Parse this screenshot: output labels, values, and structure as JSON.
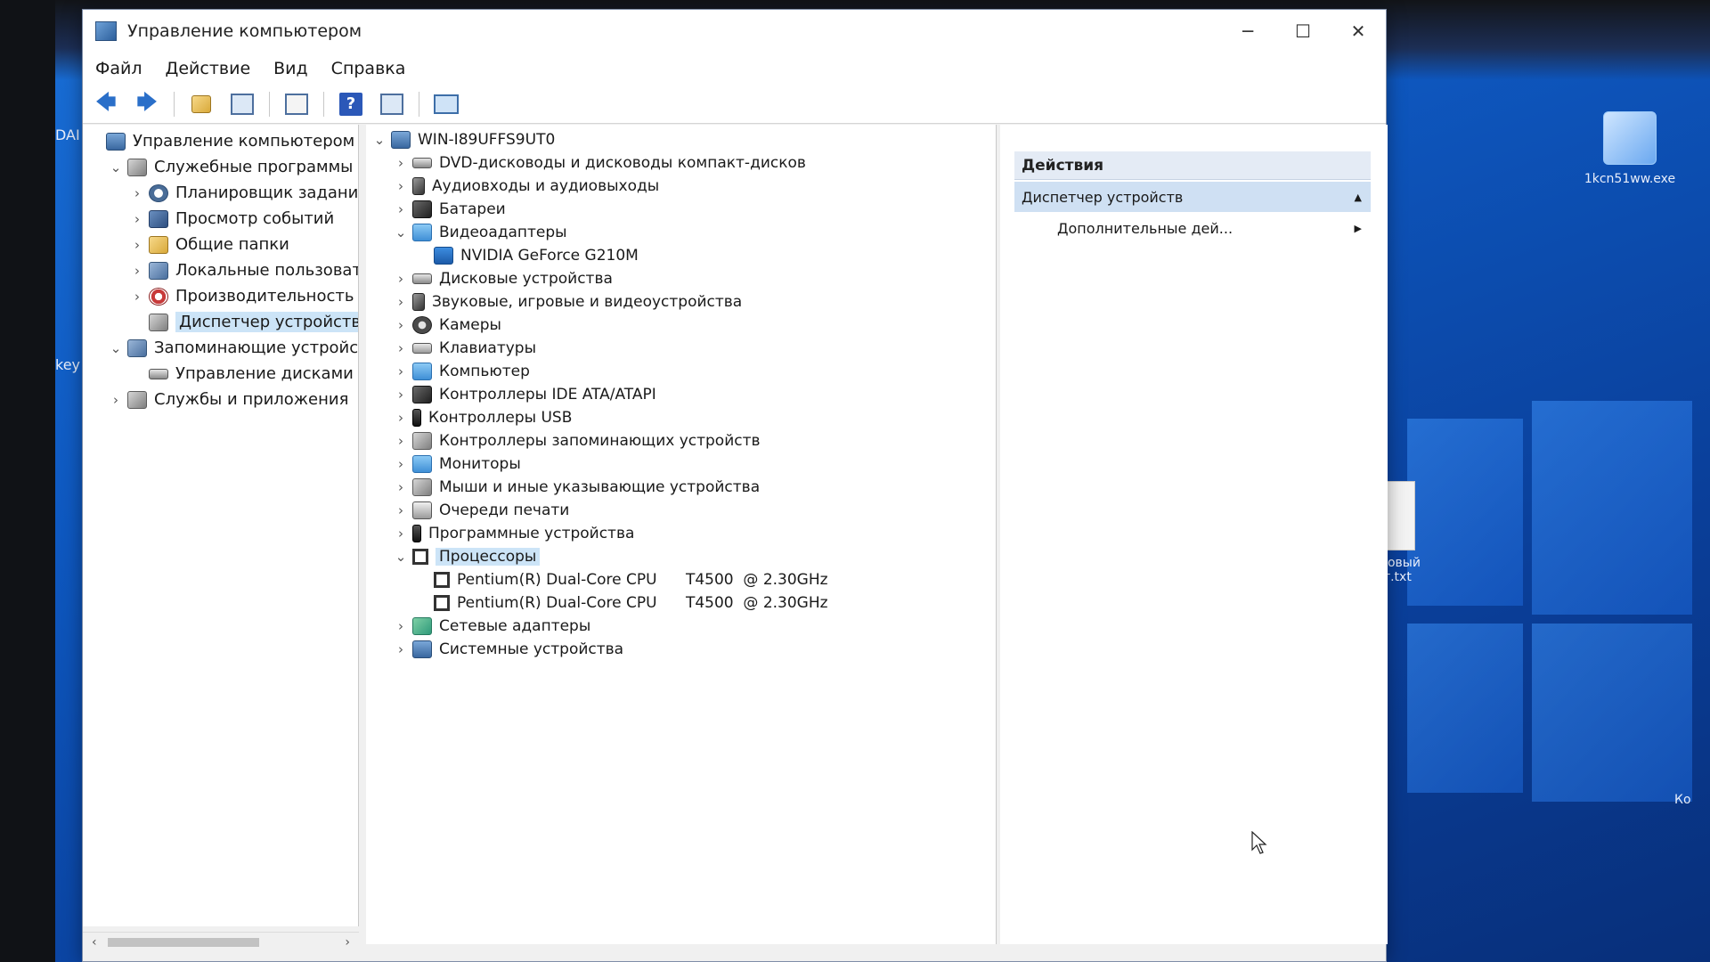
{
  "window": {
    "title": "Управление компьютером",
    "minimize": "─",
    "maximize": "☐",
    "close": "✕"
  },
  "menu": [
    "Файл",
    "Действие",
    "Вид",
    "Справка"
  ],
  "toolbar": {
    "back": "🡄",
    "forward": "🡆",
    "help": "?"
  },
  "left_tree": [
    {
      "label": "Управление компьютером (л",
      "chev": "",
      "icon": "ico-host",
      "indent": 0,
      "selected": false
    },
    {
      "label": "Служебные программы",
      "chev": "⌄",
      "icon": "ico-gray",
      "indent": 1,
      "selected": false
    },
    {
      "label": "Планировщик заданий",
      "chev": "›",
      "icon": "ico-clock",
      "indent": 2,
      "selected": false
    },
    {
      "label": "Просмотр событий",
      "chev": "›",
      "icon": "ico-book",
      "indent": 2,
      "selected": false
    },
    {
      "label": "Общие папки",
      "chev": "›",
      "icon": "ico-folder",
      "indent": 2,
      "selected": false
    },
    {
      "label": "Локальные пользовате",
      "chev": "›",
      "icon": "ico-users",
      "indent": 2,
      "selected": false
    },
    {
      "label": "Производительность",
      "chev": "›",
      "icon": "ico-red",
      "indent": 2,
      "selected": false
    },
    {
      "label": "Диспетчер устройств",
      "chev": "",
      "icon": "ico-gray",
      "indent": 2,
      "selected": true
    },
    {
      "label": "Запоминающие устройст",
      "chev": "⌄",
      "icon": "ico-users",
      "indent": 1,
      "selected": false
    },
    {
      "label": "Управление дисками",
      "chev": "",
      "icon": "ico-disk",
      "indent": 2,
      "selected": false
    },
    {
      "label": "Службы и приложения",
      "chev": "›",
      "icon": "ico-gray",
      "indent": 1,
      "selected": false
    }
  ],
  "device_tree": [
    {
      "label": "WIN-I89UFFS9UT0",
      "chev": "⌄",
      "icon": "ico-host",
      "indent": 0,
      "selected": false
    },
    {
      "label": "DVD-дисководы и дисководы компакт-дисков",
      "chev": "›",
      "icon": "ico-disk",
      "indent": 1,
      "selected": false
    },
    {
      "label": "Аудиовходы и аудиовыходы",
      "chev": "›",
      "icon": "ico-speaker",
      "indent": 1,
      "selected": false
    },
    {
      "label": "Батареи",
      "chev": "›",
      "icon": "ico-dark",
      "indent": 1,
      "selected": false
    },
    {
      "label": "Видеоадаптеры",
      "chev": "⌄",
      "icon": "ico-monitor",
      "indent": 1,
      "selected": false
    },
    {
      "label": "NVIDIA GeForce G210M",
      "chev": "",
      "icon": "ico-nvidia",
      "indent": 2,
      "selected": false
    },
    {
      "label": "Дисковые устройства",
      "chev": "›",
      "icon": "ico-disk",
      "indent": 1,
      "selected": false
    },
    {
      "label": "Звуковые, игровые и видеоустройства",
      "chev": "›",
      "icon": "ico-speaker",
      "indent": 1,
      "selected": false
    },
    {
      "label": "Камеры",
      "chev": "›",
      "icon": "ico-cam",
      "indent": 1,
      "selected": false
    },
    {
      "label": "Клавиатуры",
      "chev": "›",
      "icon": "ico-kbd",
      "indent": 1,
      "selected": false
    },
    {
      "label": "Компьютер",
      "chev": "›",
      "icon": "ico-monitor",
      "indent": 1,
      "selected": false
    },
    {
      "label": "Контроллеры IDE ATA/ATAPI",
      "chev": "›",
      "icon": "ico-dark",
      "indent": 1,
      "selected": false
    },
    {
      "label": "Контроллеры USB",
      "chev": "›",
      "icon": "ico-usb",
      "indent": 1,
      "selected": false
    },
    {
      "label": "Контроллеры запоминающих устройств",
      "chev": "›",
      "icon": "ico-gray",
      "indent": 1,
      "selected": false
    },
    {
      "label": "Мониторы",
      "chev": "›",
      "icon": "ico-monitor",
      "indent": 1,
      "selected": false
    },
    {
      "label": "Мыши и иные указывающие устройства",
      "chev": "›",
      "icon": "ico-gray",
      "indent": 1,
      "selected": false
    },
    {
      "label": "Очереди печати",
      "chev": "›",
      "icon": "ico-printer",
      "indent": 1,
      "selected": false
    },
    {
      "label": "Программные устройства",
      "chev": "›",
      "icon": "ico-usb",
      "indent": 1,
      "selected": false
    },
    {
      "label": "Процессоры",
      "chev": "⌄",
      "icon": "ico-cpu",
      "indent": 1,
      "selected": true
    },
    {
      "label": "Pentium(R) Dual-Core CPU      T4500  @ 2.30GHz",
      "chev": "",
      "icon": "ico-cpu",
      "indent": 2,
      "selected": false
    },
    {
      "label": "Pentium(R) Dual-Core CPU      T4500  @ 2.30GHz",
      "chev": "",
      "icon": "ico-cpu",
      "indent": 2,
      "selected": false
    },
    {
      "label": "Сетевые адаптеры",
      "chev": "›",
      "icon": "ico-net",
      "indent": 1,
      "selected": false
    },
    {
      "label": "Системные устройства",
      "chev": "›",
      "icon": "ico-host",
      "indent": 1,
      "selected": false
    }
  ],
  "actions": {
    "header": "Действия",
    "section": "Диспетчер устройств",
    "section_arrow": "▲",
    "more": "Дополнительные дей...",
    "more_arrow": "▶"
  },
  "desktop": {
    "exe_icon_label": "1kcn51ww.exe",
    "txt_icon_label": "екстовый\nент.txt",
    "left_edge_top": "DAI",
    "left_edge_mid": "key",
    "right_edge": "Ко"
  },
  "scroll": {
    "left": "‹",
    "right": "›"
  }
}
